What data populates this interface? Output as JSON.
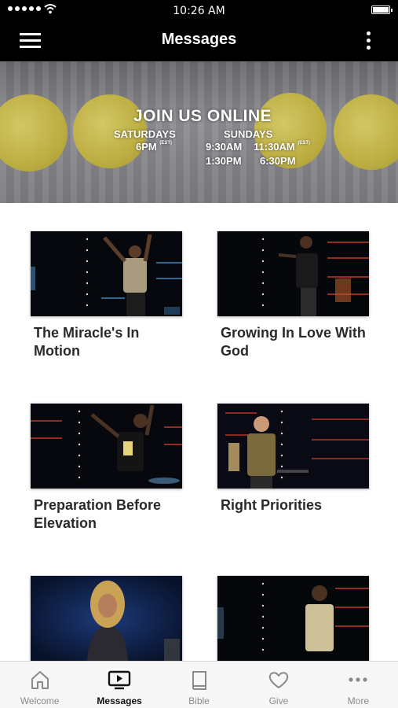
{
  "status": {
    "time": "10:26 AM"
  },
  "nav": {
    "title": "Messages"
  },
  "banner": {
    "title": "JOIN US ONLINE",
    "saturdays": "SATURDAYS",
    "sundays": "SUNDAYS",
    "sat_time": "6PM",
    "sun_time_1": "9:30AM",
    "sun_time_2": "11:30AM",
    "sun_time_3": "1:30PM",
    "sun_time_4": "6:30PM",
    "tz": "(EST)"
  },
  "messages": [
    {
      "title": "The Miracle's In Motion"
    },
    {
      "title": "Growing In Love With God"
    },
    {
      "title": "Preparation Before Elevation"
    },
    {
      "title": "Right Priorities"
    },
    {
      "title": ""
    },
    {
      "title": ""
    }
  ],
  "tabs": [
    {
      "label": "Welcome",
      "icon": "home-icon"
    },
    {
      "label": "Messages",
      "icon": "tv-play-icon"
    },
    {
      "label": "Bible",
      "icon": "book-icon"
    },
    {
      "label": "Give",
      "icon": "heart-icon"
    },
    {
      "label": "More",
      "icon": "more-dots-icon"
    }
  ]
}
